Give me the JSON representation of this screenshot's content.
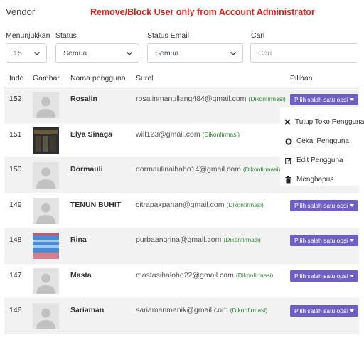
{
  "page": {
    "title": "Vendor",
    "warning": "Remove/Block User only from Account Administrator"
  },
  "filters": {
    "show_label": "Menunjukkan",
    "show_value": "15",
    "status_label": "Status",
    "status_value": "Semua",
    "email_status_label": "Status Email",
    "email_status_value": "Semua",
    "search_label": "Cari",
    "search_placeholder": "Cari"
  },
  "table": {
    "headers": {
      "index": "Indo",
      "image": "Gambar",
      "username": "Nama pengguna",
      "email": "Surel",
      "options": "Pilihan"
    },
    "confirmed_label": "(Dikonfirmasi)",
    "option_button": "Pilih salah satu opsi",
    "rows": [
      {
        "index": "152",
        "name": "Rosalin",
        "email": "rosalinmanullang484@gmail.com",
        "avatar": "placeholder"
      },
      {
        "index": "151",
        "name": "Elya Sinaga",
        "email": "will123@gmail.com",
        "avatar": "photo-dark"
      },
      {
        "index": "150",
        "name": "Dormauli",
        "email": "dormaulinaibaho14@gmail.com",
        "avatar": "placeholder"
      },
      {
        "index": "149",
        "name": "TENUN BUHIT",
        "email": "citrapakpahan@gmail.com",
        "avatar": "placeholder"
      },
      {
        "index": "148",
        "name": "Rina",
        "email": "purbaangrina@gmail.com",
        "avatar": "photo-blue"
      },
      {
        "index": "147",
        "name": "Masta",
        "email": "mastasihaloho22@gmail.com",
        "avatar": "placeholder"
      },
      {
        "index": "146",
        "name": "Sariaman",
        "email": "sariamanmanik@gmail.com",
        "avatar": "placeholder"
      }
    ]
  },
  "dropdown_menu": [
    {
      "icon": "close-icon",
      "label": "Tutup Toko Pengguna"
    },
    {
      "icon": "ban-icon",
      "label": "Cekal Pengguna"
    },
    {
      "icon": "edit-icon",
      "label": "Edit Pengguna"
    },
    {
      "icon": "trash-icon",
      "label": "Menghapus"
    }
  ],
  "colors": {
    "warning": "#e0201b",
    "button": "#6f5fc4",
    "confirmed": "#2e8b3a"
  }
}
